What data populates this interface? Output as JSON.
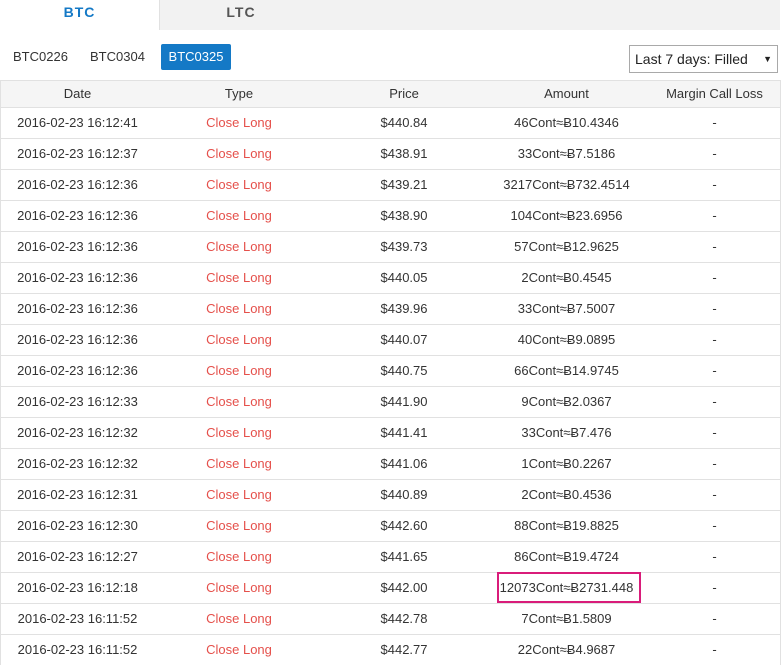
{
  "tabs": [
    {
      "label": "BTC",
      "active": true
    },
    {
      "label": "LTC",
      "active": false
    }
  ],
  "contracts": [
    {
      "label": "BTC0226",
      "active": false
    },
    {
      "label": "BTC0304",
      "active": false
    },
    {
      "label": "BTC0325",
      "active": true
    }
  ],
  "filter": {
    "selected": "Last 7 days: Filled",
    "arrow": "▼"
  },
  "table": {
    "headers": {
      "date": "Date",
      "type": "Type",
      "price": "Price",
      "amount": "Amount",
      "loss": "Margin Call Loss"
    },
    "rows": [
      {
        "date": "2016-02-23 16:12:41",
        "type": "Close Long",
        "price": "$440.84",
        "amount": "46Cont≈Ƀ10.4346",
        "loss": "-"
      },
      {
        "date": "2016-02-23 16:12:37",
        "type": "Close Long",
        "price": "$438.91",
        "amount": "33Cont≈Ƀ7.5186",
        "loss": "-"
      },
      {
        "date": "2016-02-23 16:12:36",
        "type": "Close Long",
        "price": "$439.21",
        "amount": "3217Cont≈Ƀ732.4514",
        "loss": "-"
      },
      {
        "date": "2016-02-23 16:12:36",
        "type": "Close Long",
        "price": "$438.90",
        "amount": "104Cont≈Ƀ23.6956",
        "loss": "-"
      },
      {
        "date": "2016-02-23 16:12:36",
        "type": "Close Long",
        "price": "$439.73",
        "amount": "57Cont≈Ƀ12.9625",
        "loss": "-"
      },
      {
        "date": "2016-02-23 16:12:36",
        "type": "Close Long",
        "price": "$440.05",
        "amount": "2Cont≈Ƀ0.4545",
        "loss": "-"
      },
      {
        "date": "2016-02-23 16:12:36",
        "type": "Close Long",
        "price": "$439.96",
        "amount": "33Cont≈Ƀ7.5007",
        "loss": "-"
      },
      {
        "date": "2016-02-23 16:12:36",
        "type": "Close Long",
        "price": "$440.07",
        "amount": "40Cont≈Ƀ9.0895",
        "loss": "-"
      },
      {
        "date": "2016-02-23 16:12:36",
        "type": "Close Long",
        "price": "$440.75",
        "amount": "66Cont≈Ƀ14.9745",
        "loss": "-"
      },
      {
        "date": "2016-02-23 16:12:33",
        "type": "Close Long",
        "price": "$441.90",
        "amount": "9Cont≈Ƀ2.0367",
        "loss": "-"
      },
      {
        "date": "2016-02-23 16:12:32",
        "type": "Close Long",
        "price": "$441.41",
        "amount": "33Cont≈Ƀ7.476",
        "loss": "-"
      },
      {
        "date": "2016-02-23 16:12:32",
        "type": "Close Long",
        "price": "$441.06",
        "amount": "1Cont≈Ƀ0.2267",
        "loss": "-"
      },
      {
        "date": "2016-02-23 16:12:31",
        "type": "Close Long",
        "price": "$440.89",
        "amount": "2Cont≈Ƀ0.4536",
        "loss": "-"
      },
      {
        "date": "2016-02-23 16:12:30",
        "type": "Close Long",
        "price": "$442.60",
        "amount": "88Cont≈Ƀ19.8825",
        "loss": "-"
      },
      {
        "date": "2016-02-23 16:12:27",
        "type": "Close Long",
        "price": "$441.65",
        "amount": "86Cont≈Ƀ19.4724",
        "loss": "-"
      },
      {
        "date": "2016-02-23 16:12:18",
        "type": "Close Long",
        "price": "$442.00",
        "amount": "12073Cont≈Ƀ2731.448",
        "loss": "-"
      },
      {
        "date": "2016-02-23 16:11:52",
        "type": "Close Long",
        "price": "$442.78",
        "amount": "7Cont≈Ƀ1.5809",
        "loss": "-"
      },
      {
        "date": "2016-02-23 16:11:52",
        "type": "Close Long",
        "price": "$442.77",
        "amount": "22Cont≈Ƀ4.9687",
        "loss": "-"
      }
    ]
  },
  "colors": {
    "accent": "#1479c6",
    "close_long": "#e5504b",
    "highlight": "#d91c7a"
  }
}
